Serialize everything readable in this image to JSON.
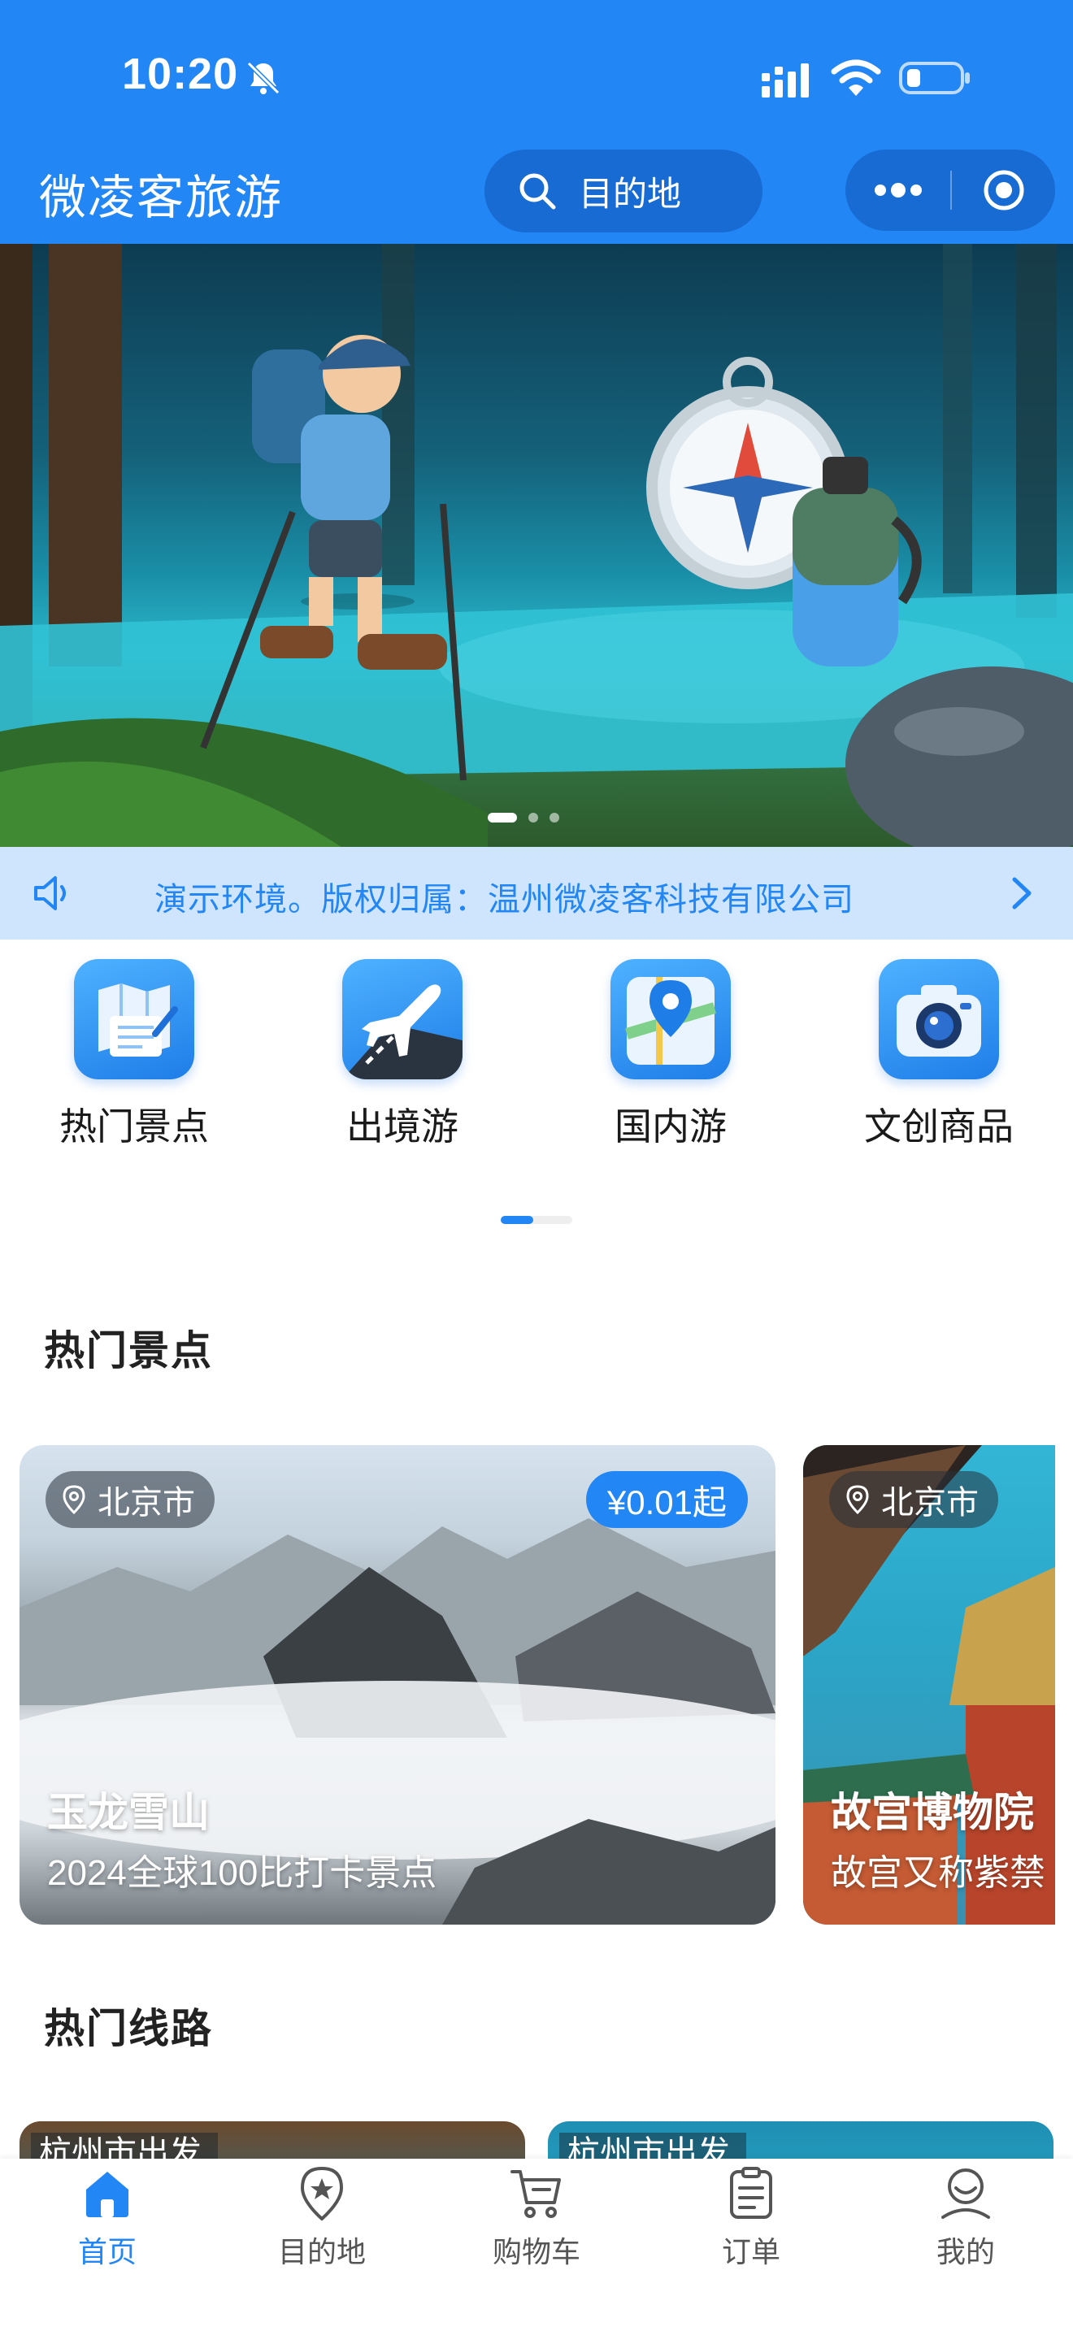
{
  "status_bar": {
    "time": "10:20"
  },
  "header": {
    "title": "微凌客旅游",
    "search_label": "目的地"
  },
  "notice": {
    "text": "演示环境。版权归属：温州微凌客科技有限公司"
  },
  "categories": [
    {
      "label": "热门景点"
    },
    {
      "label": "出境游"
    },
    {
      "label": "国内游"
    },
    {
      "label": "文创商品"
    }
  ],
  "sections": {
    "hot_spots": "热门景点",
    "hot_routes": "热门线路"
  },
  "spots": [
    {
      "city": "北京市",
      "price": "¥0.01起",
      "name": "玉龙雪山",
      "desc": "2024全球100比打卡景点"
    },
    {
      "city": "北京市",
      "name": "故宫博物院",
      "desc": "故宫又称紫禁"
    }
  ],
  "routes": [
    {
      "from": "杭州市出发"
    },
    {
      "from": "杭州市出发"
    }
  ],
  "tabbar": [
    {
      "label": "首页",
      "active": true
    },
    {
      "label": "目的地"
    },
    {
      "label": "购物车"
    },
    {
      "label": "订单"
    },
    {
      "label": "我的"
    }
  ],
  "colors": {
    "brand": "#2386f5",
    "brand_dark": "#176bd3",
    "notice_bg": "#cfe5fd"
  }
}
